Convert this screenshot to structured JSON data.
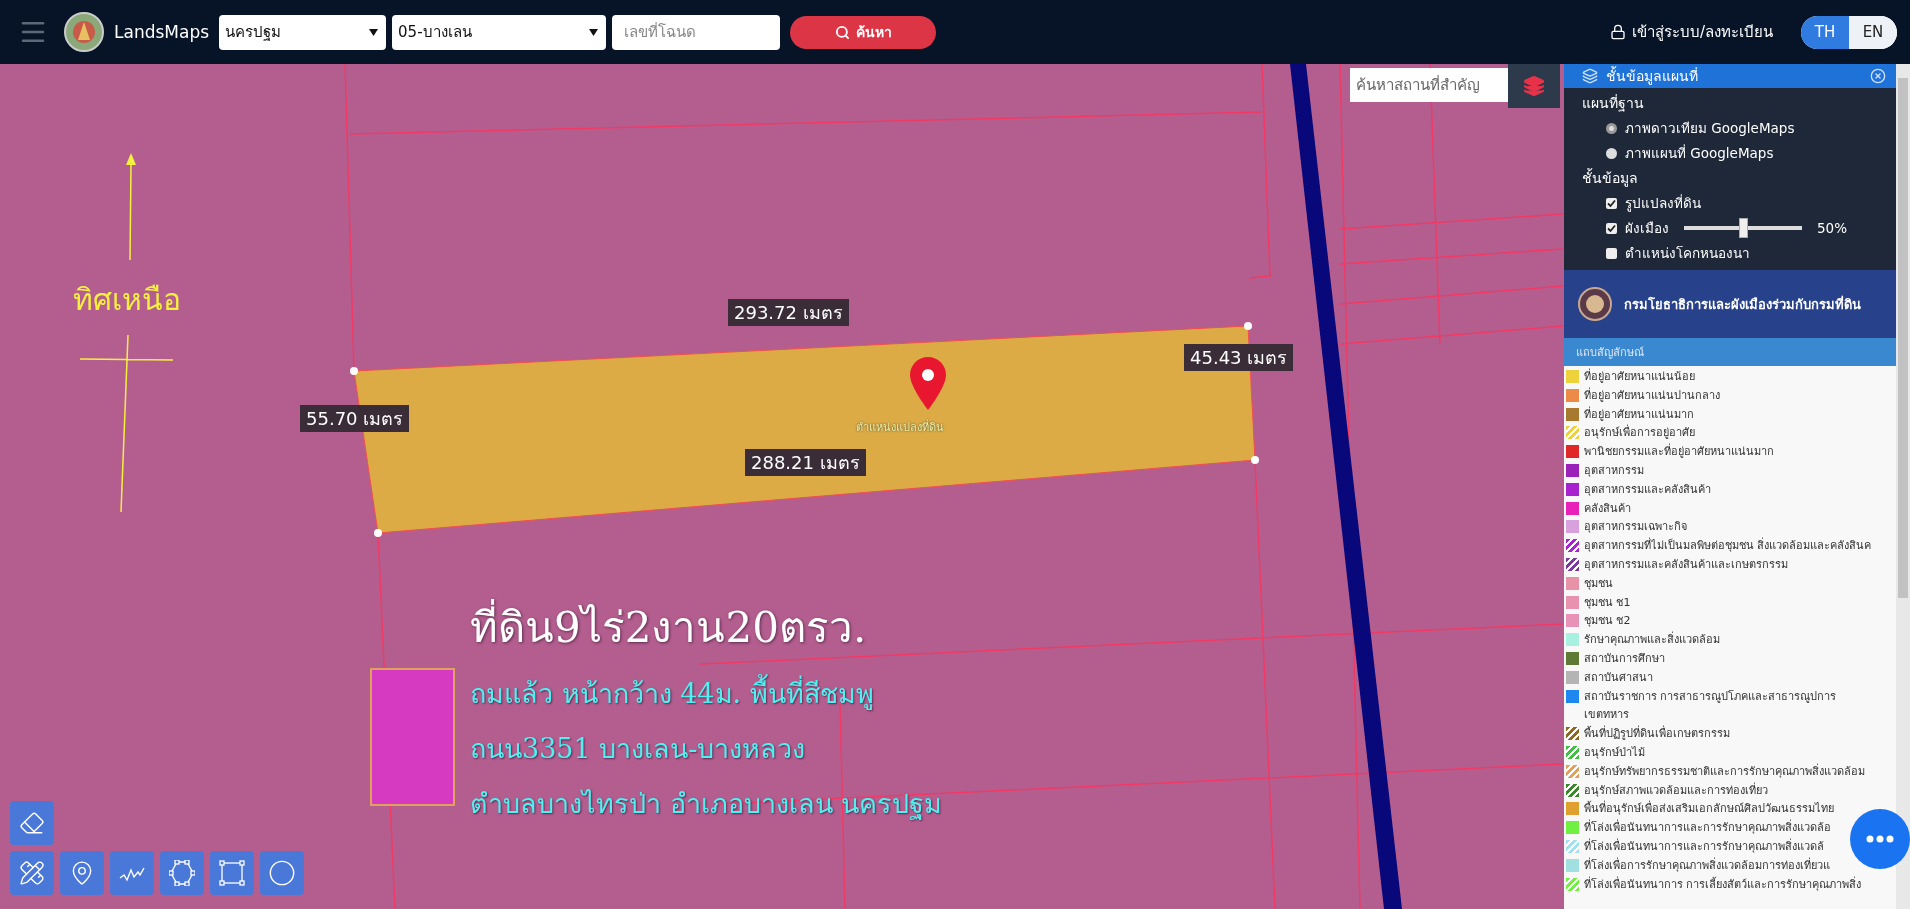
{
  "header": {
    "app_name": "LandsMaps",
    "province_select": {
      "value": "นครปฐม"
    },
    "district_select": {
      "value": "05-บางเลน"
    },
    "deed_field": {
      "placeholder": "เลขที่โฉนด"
    },
    "search_button": {
      "label": "ค้นหา"
    },
    "login_link": "เข้าสู่ระบบ/ลงทะเบียน",
    "languages": [
      {
        "label": "TH",
        "selected": true
      },
      {
        "label": "EN",
        "selected": false
      }
    ]
  },
  "map": {
    "place_search": {
      "placeholder": "ค้นหาสถานที่สำคัญ"
    },
    "north_label": "ทิศเหนือ",
    "measurements": [
      {
        "label": "293.72 เมตร"
      },
      {
        "label": "45.43 เมตร"
      },
      {
        "label": "55.70 เมตร"
      },
      {
        "label": "288.21 เมตร"
      }
    ],
    "parcel_label": "ตำแหน่งแปลงที่ดิน",
    "annotation": {
      "title": "ที่ดิน9ไร่2งาน20ตรว.",
      "lines": [
        "ถมแล้ว หน้ากว้าง 44ม. พื้นที่สีชมพู",
        "ถนน3351 บางเลน-บางหลวง",
        "ตำบลบางไทรป่า  อำเภอบางเลน นครปฐม"
      ]
    }
  },
  "layer_panel": {
    "title": "ชั้นข้อมูลแผนที่",
    "base_map_heading": "แผนที่ฐาน",
    "base_maps": [
      {
        "label": "ภาพดาวเทียม GoogleMaps",
        "selected": true
      },
      {
        "label": "ภาพแผนที่ GoogleMaps",
        "selected": false
      }
    ],
    "layers_heading": "ชั้นข้อมูล",
    "layers": [
      {
        "label": "รูปแปลงที่ดิน",
        "checked": true
      },
      {
        "label": "ผังเมือง",
        "checked": true,
        "opacity": {
          "level": 0.5,
          "reading": "50%"
        }
      },
      {
        "label": "ตำแหน่งโคกหนองนา",
        "checked": false
      }
    ],
    "department": "กรมโยธาธิการและผังเมืองร่วมกับกรมที่ดิน",
    "legend_title": "แถบสัญลักษณ์",
    "legend": [
      {
        "label": "ที่อยู่อาศัยหนาแน่นน้อย",
        "color": "#eed23c",
        "kind": "solid"
      },
      {
        "label": "ที่อยู่อาศัยหนาแน่นปานกลาง",
        "color": "#ee8a48",
        "kind": "solid"
      },
      {
        "label": "ที่อยู่อาศัยหนาแน่นมาก",
        "color": "#a87a30",
        "kind": "solid"
      },
      {
        "label": "อนุรักษ์เพื่อการอยู่อาศัย",
        "color": "#eed23c",
        "kind": "hatch"
      },
      {
        "label": "พานิชยกรรมและที่อยู่อาศัยหนาแน่นมาก",
        "color": "#e02828",
        "kind": "solid"
      },
      {
        "label": "อุตสาหกรรม",
        "color": "#9a22b8",
        "kind": "solid"
      },
      {
        "label": "อุตสาหกรรมและคลังสินค้า",
        "color": "#a822d0",
        "kind": "solid"
      },
      {
        "label": "คลังสินค้า",
        "color": "#e822b8",
        "kind": "solid"
      },
      {
        "label": "อุตสาหกรรมเฉพาะกิจ",
        "color": "#d8a0dc",
        "kind": "solid"
      },
      {
        "label": "อุตสาหกรรมที่ไม่เป็นมลพิษต่อชุมชน สิ่งแวดล้อมและคลังสินค",
        "color": "#a822d0",
        "kind": "hatch"
      },
      {
        "label": "อุตสาหกรรมและคลังสินค้าและเกษตรกรรม",
        "color": "#7a3aa0",
        "kind": "hatch"
      },
      {
        "label": "ชุมชน",
        "color": "#e892a8",
        "kind": "solid"
      },
      {
        "label": "ชุมชน  ช1",
        "color": "#e892b0",
        "kind": "solid"
      },
      {
        "label": "ชุมชน  ช2",
        "color": "#e892b8",
        "kind": "solid"
      },
      {
        "label": "รักษาคุณภาพและสิ่งแวดล้อม",
        "color": "#a8f0e0",
        "kind": "solid"
      },
      {
        "label": "สถาบันการศึกษา",
        "color": "#5e7a34",
        "kind": "solid"
      },
      {
        "label": "สถาบันศาสนา",
        "color": "#b4b4b4",
        "kind": "solid"
      },
      {
        "label": "สถาบันราชการ การสาธารณูปโภคและสาธารณูปการ",
        "color": "#1e88f0",
        "kind": "solid"
      },
      {
        "label": "เขตทหาร",
        "kind": "none"
      },
      {
        "label": "พื้นที่ปฏิรูปที่ดินเพื่อเกษตรกรรม",
        "color": "#8a6a24",
        "kind": "hatch"
      },
      {
        "label": "อนุรักษ์ป่าไม้",
        "color": "#40c040",
        "kind": "hatch"
      },
      {
        "label": "อนุรักษ์ทรัพยากรธรรมชาติและการรักษาคุณภาพสิ่งแวดล้อม",
        "color": "#e0a060",
        "kind": "hatch"
      },
      {
        "label": "อนุรักษ์สภาพแวดล้อมและการท่องเที่ยว",
        "color": "#3a8a2a",
        "kind": "hatch"
      },
      {
        "label": "พื้นที่อนุรักษ์เพื่อส่งเสริมเอกลักษณ์ศิลปวัฒนธรรมไทย",
        "color": "#e0a030",
        "kind": "solid"
      },
      {
        "label": "ที่โล่งเพื่อนันทนาการและการรักษาคุณภาพสิ่งแวดล้อ",
        "color": "#70f040",
        "kind": "solid"
      },
      {
        "label": "ที่โล่งเพื่อนันทนาการและการรักษาคุณภาพสิ่งแวดล้",
        "color": "#a0e0f0",
        "kind": "hatch"
      },
      {
        "label": "ที่โล่งเพื่อการรักษาคุณภาพสิ่งแวดล้อมการท่องเที่ยวแ",
        "color": "#a0e0e0",
        "kind": "solid"
      },
      {
        "label": "ที่โล่งเพื่อนันทนาการ การเลี้ยงสัตว์และการรักษาคุณภาพสิ่ง",
        "color": "#70f040",
        "kind": "hatch"
      }
    ]
  }
}
